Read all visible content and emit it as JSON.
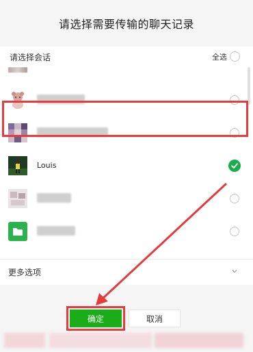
{
  "title": "请选择需要传输的聊天记录",
  "select_header": {
    "label": "请选择会话",
    "select_all_label": "全选"
  },
  "conversations": [
    {
      "name": "",
      "selected": false
    },
    {
      "name": "",
      "selected": false
    },
    {
      "name": "Louis",
      "selected": true
    },
    {
      "name": "",
      "selected": false
    },
    {
      "name": "",
      "selected": false
    }
  ],
  "more_options": {
    "label": "更多选项"
  },
  "buttons": {
    "confirm": "确定",
    "cancel": "取消"
  },
  "colors": {
    "accent_green": "#1aad19",
    "check_green": "#1aad4e",
    "annotation_red": "#e53b3b"
  }
}
